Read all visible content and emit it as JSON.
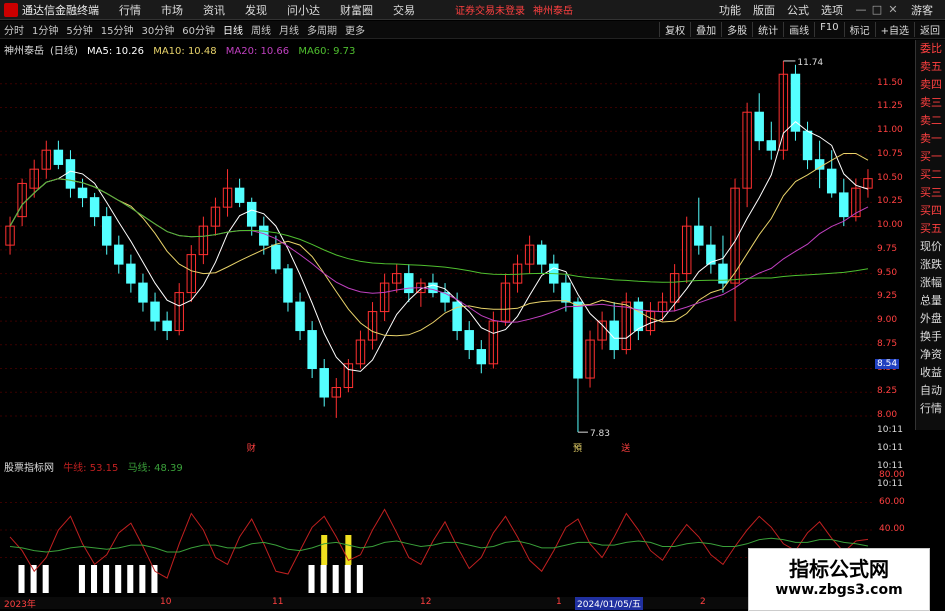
{
  "topbar": {
    "app_name": "通达信金融终端",
    "menu": [
      "行情",
      "市场",
      "资讯",
      "发现",
      "问小达",
      "财富圈",
      "交易"
    ],
    "notice": "证券交易未登录",
    "stock_title": "神州泰岳",
    "right_menu": [
      "功能",
      "版面",
      "公式",
      "选项"
    ],
    "guest": "游客"
  },
  "periodbar": {
    "periods": [
      "分时",
      "1分钟",
      "5分钟",
      "15分钟",
      "30分钟",
      "60分钟",
      "日线",
      "周线",
      "月线",
      "多周期",
      "更多"
    ],
    "active": "日线",
    "tools": [
      "复权",
      "叠加",
      "多股",
      "统计",
      "画线",
      "F10",
      "标记",
      "+自选",
      "返回"
    ]
  },
  "main_legend": {
    "stock": "神州泰岳",
    "period": "(日线)",
    "ma5": "MA5: 10.26",
    "ma10": "MA10: 10.48",
    "ma20": "MA20: 10.66",
    "ma60": "MA60: 9.73"
  },
  "price_axis": [
    "11.50",
    "11.25",
    "11.00",
    "10.75",
    "10.50",
    "10.25",
    "10.00",
    "9.75",
    "9.50",
    "9.25",
    "9.00",
    "8.75",
    "8.50",
    "8.25",
    "8.00"
  ],
  "current_price_tag": "8.54",
  "time_tags": [
    "10:11",
    "10:11",
    "10:11",
    "10:11"
  ],
  "annotations": {
    "high_label": "11.74",
    "low_label": "7.83",
    "events": [
      "财",
      "預",
      "送"
    ]
  },
  "indicator_legend": {
    "name": "股票指标网",
    "line1": "牛线: 53.15",
    "line2": "马线: 48.39"
  },
  "indicator_axis": [
    "80.00",
    "60.00",
    "40.00"
  ],
  "x_axis": [
    "2023年",
    "10",
    "11",
    "12",
    "2024/01/05/五",
    "1",
    "2"
  ],
  "side_panel": [
    "委比",
    "卖五",
    "卖四",
    "卖三",
    "卖二",
    "卖一",
    "买一",
    "买二",
    "买三",
    "买四",
    "买五",
    "现价",
    "涨跌",
    "涨幅",
    "总量",
    "外盘",
    "换手",
    "净资",
    "收益",
    "自动",
    "行情"
  ],
  "watermark": {
    "line1": "指标公式网",
    "line2": "www.zbgs3.com"
  },
  "colors": {
    "up": "#ff3030",
    "down": "#54ffff",
    "ma5": "#ffffff",
    "ma10": "#e8d36a",
    "ma20": "#c040c0",
    "ma60": "#4fbf2f",
    "bull": "#c02020",
    "horse": "#3aa03a"
  },
  "chart_data": {
    "type": "candlestick",
    "ylim": [
      7.8,
      11.75
    ],
    "candles": [
      [
        9.8,
        10.1,
        9.7,
        10.0
      ],
      [
        10.1,
        10.5,
        10.0,
        10.45
      ],
      [
        10.4,
        10.7,
        10.3,
        10.6
      ],
      [
        10.6,
        10.9,
        10.5,
        10.8
      ],
      [
        10.8,
        10.9,
        10.6,
        10.65
      ],
      [
        10.7,
        10.8,
        10.3,
        10.4
      ],
      [
        10.4,
        10.5,
        10.2,
        10.3
      ],
      [
        10.3,
        10.35,
        10.0,
        10.1
      ],
      [
        10.1,
        10.2,
        9.7,
        9.8
      ],
      [
        9.8,
        9.9,
        9.5,
        9.6
      ],
      [
        9.6,
        9.7,
        9.3,
        9.4
      ],
      [
        9.4,
        9.5,
        9.1,
        9.2
      ],
      [
        9.2,
        9.3,
        8.9,
        9.0
      ],
      [
        9.0,
        9.1,
        8.8,
        8.9
      ],
      [
        8.9,
        9.4,
        8.85,
        9.3
      ],
      [
        9.3,
        9.8,
        9.2,
        9.7
      ],
      [
        9.7,
        10.1,
        9.6,
        10.0
      ],
      [
        10.0,
        10.3,
        9.9,
        10.2
      ],
      [
        10.2,
        10.6,
        10.1,
        10.4
      ],
      [
        10.4,
        10.5,
        10.2,
        10.25
      ],
      [
        10.25,
        10.3,
        9.9,
        10.0
      ],
      [
        10.0,
        10.1,
        9.7,
        9.8
      ],
      [
        9.8,
        9.9,
        9.5,
        9.55
      ],
      [
        9.55,
        9.6,
        9.1,
        9.2
      ],
      [
        9.2,
        9.3,
        8.8,
        8.9
      ],
      [
        8.9,
        9.0,
        8.4,
        8.5
      ],
      [
        8.5,
        8.6,
        8.1,
        8.2
      ],
      [
        8.2,
        8.4,
        7.98,
        8.3
      ],
      [
        8.3,
        8.6,
        8.25,
        8.55
      ],
      [
        8.55,
        8.9,
        8.5,
        8.8
      ],
      [
        8.8,
        9.2,
        8.7,
        9.1
      ],
      [
        9.1,
        9.5,
        9.0,
        9.4
      ],
      [
        9.4,
        9.6,
        9.3,
        9.5
      ],
      [
        9.5,
        9.6,
        9.2,
        9.3
      ],
      [
        9.3,
        9.45,
        9.15,
        9.4
      ],
      [
        9.4,
        9.5,
        9.25,
        9.3
      ],
      [
        9.3,
        9.4,
        9.1,
        9.2
      ],
      [
        9.2,
        9.3,
        8.8,
        8.9
      ],
      [
        8.9,
        9.0,
        8.6,
        8.7
      ],
      [
        8.7,
        8.8,
        8.45,
        8.55
      ],
      [
        8.55,
        9.1,
        8.5,
        9.0
      ],
      [
        9.0,
        9.5,
        8.95,
        9.4
      ],
      [
        9.4,
        9.7,
        9.3,
        9.6
      ],
      [
        9.6,
        9.9,
        9.5,
        9.8
      ],
      [
        9.8,
        9.85,
        9.5,
        9.6
      ],
      [
        9.6,
        9.7,
        9.3,
        9.4
      ],
      [
        9.4,
        9.5,
        9.1,
        9.2
      ],
      [
        9.2,
        9.25,
        7.83,
        8.4
      ],
      [
        8.4,
        8.9,
        8.3,
        8.8
      ],
      [
        8.8,
        9.1,
        8.7,
        9.0
      ],
      [
        9.0,
        9.2,
        8.6,
        8.7
      ],
      [
        8.7,
        9.3,
        8.65,
        9.2
      ],
      [
        9.2,
        9.25,
        8.8,
        8.9
      ],
      [
        8.9,
        9.2,
        8.85,
        9.1
      ],
      [
        9.1,
        9.3,
        9.0,
        9.2
      ],
      [
        9.2,
        9.6,
        9.1,
        9.5
      ],
      [
        9.5,
        10.1,
        9.4,
        10.0
      ],
      [
        10.0,
        10.3,
        9.7,
        9.8
      ],
      [
        9.8,
        10.0,
        9.5,
        9.6
      ],
      [
        9.6,
        9.9,
        9.3,
        9.4
      ],
      [
        9.4,
        10.5,
        9.0,
        10.4
      ],
      [
        10.4,
        11.3,
        10.2,
        11.2
      ],
      [
        11.2,
        11.4,
        10.8,
        10.9
      ],
      [
        10.9,
        11.1,
        10.7,
        10.8
      ],
      [
        10.8,
        11.74,
        10.7,
        11.6
      ],
      [
        11.6,
        11.7,
        10.9,
        11.0
      ],
      [
        11.0,
        11.1,
        10.6,
        10.7
      ],
      [
        10.7,
        10.9,
        10.4,
        10.6
      ],
      [
        10.6,
        10.8,
        10.3,
        10.35
      ],
      [
        10.35,
        10.5,
        10.0,
        10.1
      ],
      [
        10.1,
        10.5,
        10.05,
        10.4
      ],
      [
        10.4,
        10.6,
        10.3,
        10.5
      ]
    ],
    "indicator": {
      "bull": [
        55,
        45,
        30,
        40,
        60,
        70,
        50,
        35,
        42,
        58,
        65,
        48,
        30,
        25,
        50,
        72,
        60,
        40,
        35,
        55,
        68,
        50,
        30,
        28,
        45,
        62,
        70,
        55,
        38,
        42,
        60,
        75,
        58,
        40,
        35,
        52,
        66,
        48,
        32,
        40,
        58,
        70,
        55,
        38,
        30,
        45,
        62,
        68,
        50,
        40,
        55,
        72,
        60,
        45,
        38,
        52,
        64,
        55,
        42,
        35,
        48,
        60,
        70,
        62,
        50,
        45,
        58,
        66,
        54,
        44,
        52,
        53.15
      ],
      "horse": [
        48,
        47,
        45,
        44,
        45,
        47,
        48,
        47,
        46,
        47,
        49,
        49,
        47,
        44,
        44,
        47,
        49,
        49,
        47,
        47,
        50,
        51,
        49,
        46,
        45,
        47,
        50,
        51,
        49,
        47,
        48,
        51,
        52,
        50,
        48,
        49,
        51,
        51,
        49,
        47,
        48,
        51,
        52,
        50,
        47,
        47,
        49,
        51,
        51,
        49,
        49,
        51,
        52,
        51,
        48,
        48,
        50,
        51,
        50,
        48,
        48,
        50,
        53,
        54,
        53,
        51,
        51,
        53,
        53,
        51,
        50,
        48.39
      ]
    }
  }
}
